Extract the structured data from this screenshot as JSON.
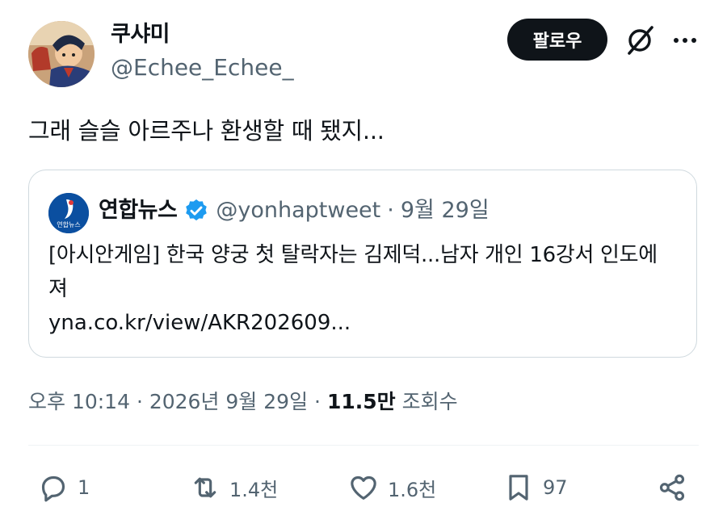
{
  "author": {
    "display_name": "쿠샤미",
    "handle": "@Echee_Echee_"
  },
  "header": {
    "follow_label": "팔로우"
  },
  "tweet": {
    "text": "그래 슬슬 아르주나 환생할 때 됐지..."
  },
  "quote": {
    "name": "연합뉴스",
    "avatar_text": "연합뉴스",
    "handle": "@yonhaptweet",
    "separator": "·",
    "date": "9월 29일",
    "body": "[아시안게임] 한국 양궁 첫 탈락자는 김제덕...남자 개인 16강서 인도에 져",
    "link": "yna.co.kr/view/AKR202609..."
  },
  "meta": {
    "time_date": "오후 10:14 · 2026년 9월 29일",
    "separator": "·",
    "views_count": "11.5만",
    "views_label": "조회수"
  },
  "actions": {
    "reply_count": "1",
    "retweet_count": "1.4천",
    "like_count": "1.6천",
    "bookmark_count": "97"
  },
  "colors": {
    "text": "#0f1419",
    "secondary": "#536471",
    "border": "#cfd9de",
    "verified": "#1d9bf0",
    "follow_bg": "#0f1419"
  },
  "icons": {
    "grok": "grok-icon",
    "more": "more-icon",
    "verified": "verified-badge-icon",
    "reply": "reply-icon",
    "retweet": "retweet-icon",
    "like": "heart-icon",
    "bookmark": "bookmark-icon",
    "share": "share-icon"
  }
}
